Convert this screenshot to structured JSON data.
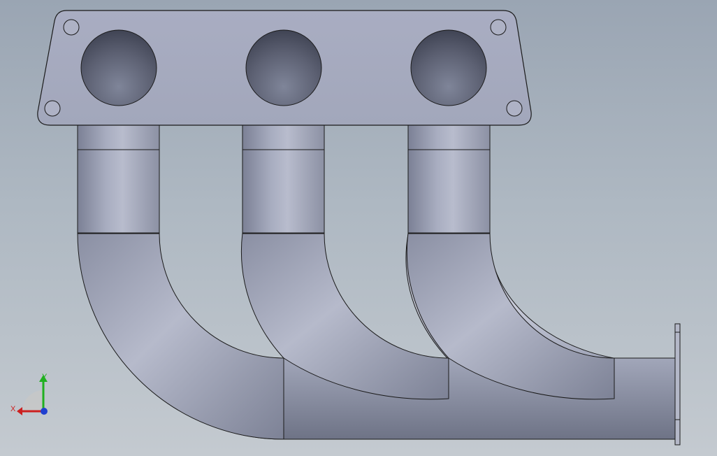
{
  "triad": {
    "x_label": "X",
    "y_label": "Y",
    "x_color": "#cc2020",
    "y_color": "#20b020",
    "z_color": "#2040d0"
  },
  "scene": {
    "model_color": "#a6abbf",
    "edge_color": "#1a1a1a",
    "background_top": "#9aa5b3",
    "background_bottom": "#c4cad0"
  }
}
